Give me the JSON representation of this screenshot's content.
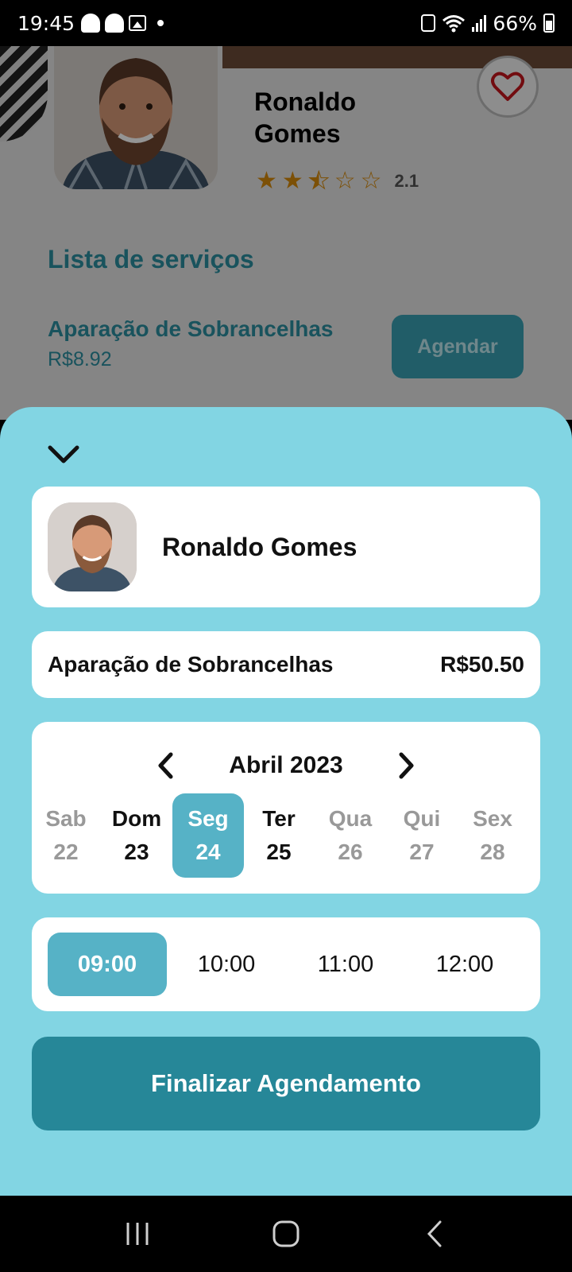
{
  "status_bar": {
    "time": "19:45",
    "battery": "66%"
  },
  "profile": {
    "name": "Ronaldo\nGomes",
    "rating": "2.1",
    "rating_value": 2.5,
    "stars_max": 5
  },
  "services": {
    "title": "Lista de serviços",
    "item_name": "Aparação de Sobrancelhas",
    "item_price": "R$8.92",
    "book_label": "Agendar"
  },
  "sheet": {
    "barber_name": "Ronaldo Gomes",
    "service_name": "Aparação de Sobrancelhas",
    "service_price": "R$50.50",
    "month": "Abril 2023",
    "days": [
      {
        "name": "Sab",
        "num": "22",
        "state": "inactive"
      },
      {
        "name": "Dom",
        "num": "23",
        "state": "active"
      },
      {
        "name": "Seg",
        "num": "24",
        "state": "selected"
      },
      {
        "name": "Ter",
        "num": "25",
        "state": "active"
      },
      {
        "name": "Qua",
        "num": "26",
        "state": "inactive"
      },
      {
        "name": "Qui",
        "num": "27",
        "state": "inactive"
      },
      {
        "name": "Sex",
        "num": "28",
        "state": "inactive"
      }
    ],
    "times": [
      "09:00",
      "10:00",
      "11:00",
      "12:00"
    ],
    "selected_time": "09:00",
    "finish_label": "Finalizar Agendamento"
  },
  "colors": {
    "sheet_bg": "#82d5e3",
    "accent": "#56b2c6",
    "primary_button": "#268798",
    "star": "#d68a0c",
    "heart": "#c4161c"
  }
}
